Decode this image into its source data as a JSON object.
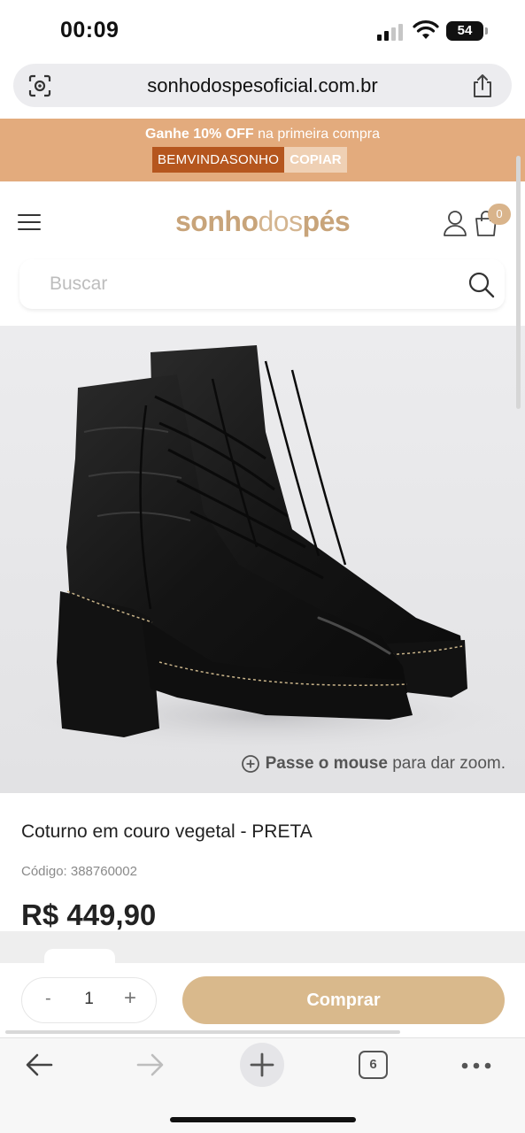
{
  "status_bar": {
    "time": "00:09",
    "battery": "54"
  },
  "browser": {
    "url": "sonhodospesoficial.com.br",
    "tab_count": "6"
  },
  "promo": {
    "highlight": "Ganhe 10% OFF",
    "text": "na primeira compra",
    "coupon_code": "BEMVINDASONHO",
    "copy_label": "COPIAR",
    "background_color": "#e3ab7d"
  },
  "header": {
    "logo": {
      "part1": "sonho",
      "part2": "dos",
      "part3": "pés"
    },
    "cart_count": "0"
  },
  "search": {
    "placeholder": "Buscar"
  },
  "product": {
    "zoom_hint_bold": "Passe o mouse",
    "zoom_hint_text": "para dar zoom.",
    "title": "Coturno em couro vegetal - PRETA",
    "code_label": "Código: 388760002",
    "price": "R$ 449,90"
  },
  "buy_bar": {
    "minus": "-",
    "quantity": "1",
    "plus": "+",
    "buy_label": "Comprar",
    "button_color": "#d9b98c"
  },
  "icons": [
    "lens-icon",
    "share-icon",
    "menu-icon",
    "user-icon",
    "cart-icon",
    "search-icon",
    "zoom-plus-icon",
    "back-arrow-icon",
    "forward-arrow-icon",
    "plus-icon",
    "more-dots-icon"
  ]
}
